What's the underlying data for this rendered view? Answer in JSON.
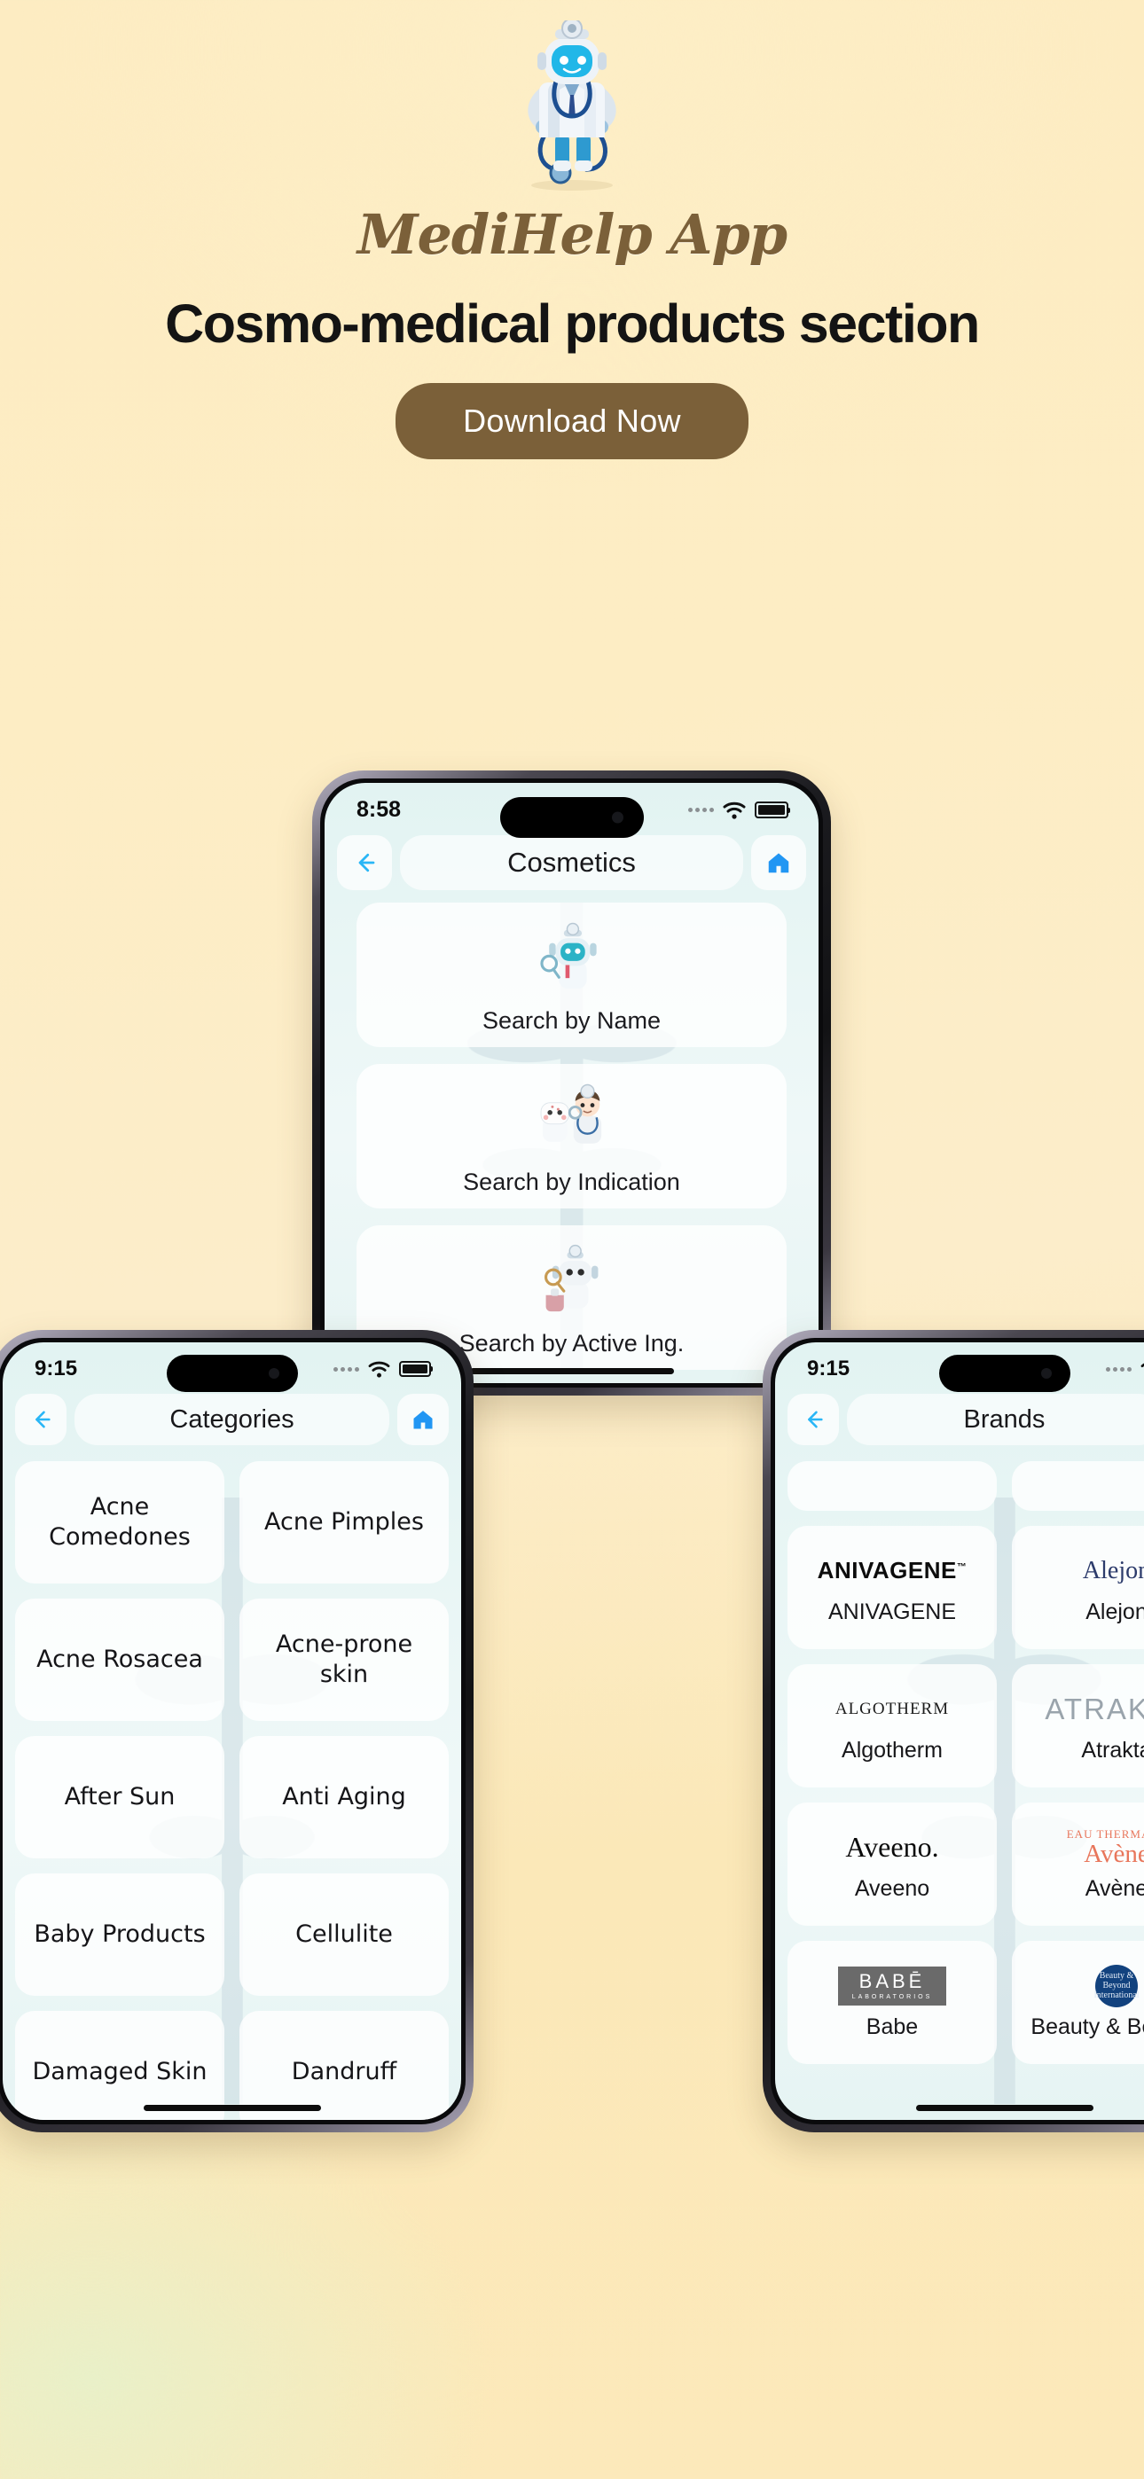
{
  "hero": {
    "brand_title": "MediHelp App",
    "headline": "Cosmo-medical products section",
    "cta_label": "Download Now",
    "mascot_icon": "robot-doctor-icon",
    "brand_color": "#7b6039",
    "background_color": "#fcecc2"
  },
  "center_phone": {
    "status": {
      "time": "8:58",
      "signal_icon": "signal-dots-icon",
      "wifi_icon": "wifi-icon",
      "battery_icon": "battery-icon"
    },
    "nav": {
      "back_icon": "arrow-left-icon",
      "title": "Cosmetics",
      "home_icon": "home-icon"
    },
    "items": [
      {
        "label": "Search by Name",
        "icon": "robot-magnifier-icon"
      },
      {
        "label": "Search by Indication",
        "icon": "doctor-patient-icon"
      },
      {
        "label": "Search by Active Ing.",
        "icon": "robot-flask-icon"
      },
      {
        "label": "",
        "icon": "robot-products-icon"
      }
    ]
  },
  "left_phone": {
    "status": {
      "time": "9:15",
      "signal_icon": "signal-dots-icon",
      "wifi_icon": "wifi-icon",
      "battery_icon": "battery-icon"
    },
    "nav": {
      "back_icon": "arrow-left-icon",
      "title": "Categories",
      "home_icon": "home-icon"
    },
    "categories": [
      "Acne Comedones",
      "Acne Pimples",
      "Acne Rosacea",
      "Acne-prone skin",
      "After Sun",
      "Anti Aging",
      "Baby Products",
      "Cellulite",
      "Damaged Skin",
      "Dandruff"
    ]
  },
  "right_phone": {
    "status": {
      "time": "9:15",
      "signal_icon": "signal-dots-icon",
      "wifi_icon": "wifi-icon",
      "battery_icon": "battery-icon"
    },
    "nav": {
      "back_icon": "arrow-left-icon",
      "title": "Brands",
      "home_icon": "home-icon"
    },
    "brands": [
      {
        "name": "",
        "logo_text": "",
        "logo_style": "blank"
      },
      {
        "name": "",
        "logo_text": "",
        "logo_style": "blank"
      },
      {
        "name": "ANIVAGENE",
        "logo_text": "ANIVAGENE",
        "logo_style": "anivagene"
      },
      {
        "name": "Alejon",
        "logo_text": "Alejon",
        "logo_style": "alejon"
      },
      {
        "name": "Algotherm",
        "logo_text": "ALGOTHERM",
        "logo_style": "algotherm"
      },
      {
        "name": "Atrakta",
        "logo_text": "ATRAKTA",
        "logo_style": "atrakta"
      },
      {
        "name": "Aveeno",
        "logo_text": "Aveeno.",
        "logo_style": "aveeno"
      },
      {
        "name": "Avène",
        "logo_text": "Avène",
        "logo_style": "avene",
        "logo_top": "EAU THERMALE"
      },
      {
        "name": "Babe",
        "logo_text": "BABĒ",
        "logo_style": "babe",
        "logo_sub": "LABORATORIOS"
      },
      {
        "name": "Beauty & Beyond",
        "logo_text": "Beauty & Beyond International",
        "logo_style": "bb"
      }
    ]
  }
}
